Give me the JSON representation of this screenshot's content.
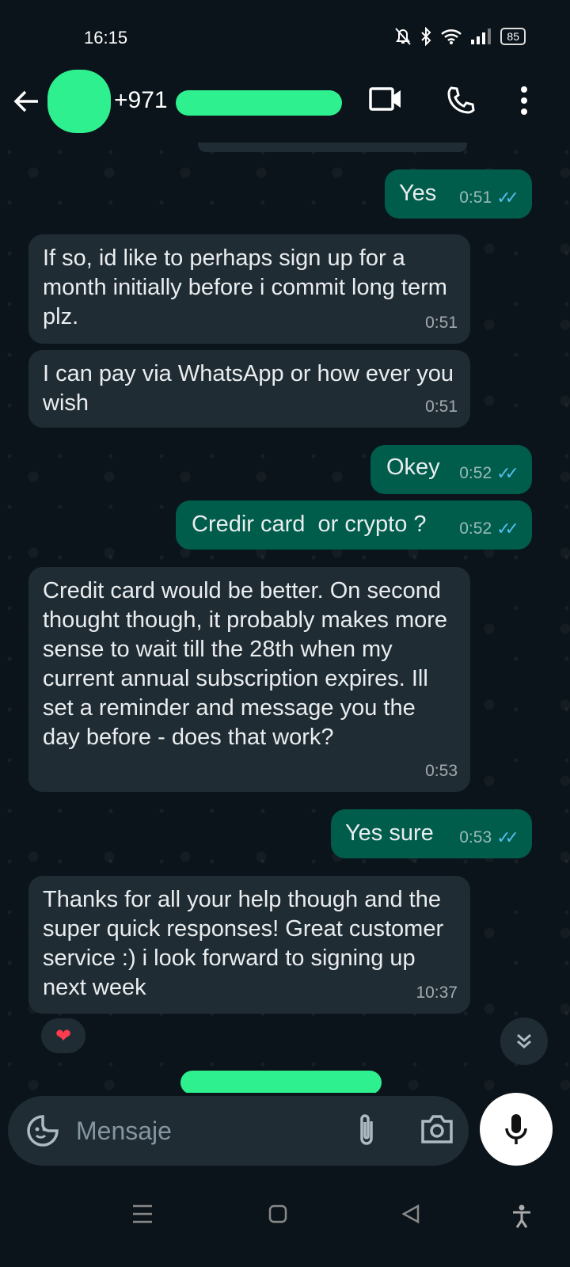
{
  "status_bar": {
    "time": "16:15",
    "battery": "85"
  },
  "header": {
    "contact": "+971"
  },
  "messages": [
    {
      "side": "out",
      "text": "Yes",
      "time": "0:51"
    },
    {
      "side": "in",
      "text": "If so, id like to perhaps sign up for a month initially before i commit long term plz.",
      "time": "0:51"
    },
    {
      "side": "in",
      "text": "I can pay via WhatsApp or how ever you wish",
      "time": "0:51"
    },
    {
      "side": "out",
      "text": "Okey",
      "time": "0:52"
    },
    {
      "side": "out",
      "text": "Credir card  or crypto ?",
      "time": "0:52"
    },
    {
      "side": "in",
      "text": "Credit card would be better. On second thought though, it probably makes more sense to wait till the 28th when my current annual subscription expires. Ill set a reminder and message you the day before - does that work?",
      "time": "0:53"
    },
    {
      "side": "out",
      "text": "Yes sure",
      "time": "0:53"
    },
    {
      "side": "in",
      "text": "Thanks for all your help though and the super quick responses! Great customer service :) i look forward to signing up next week",
      "time": "10:37",
      "reaction": "❤"
    }
  ],
  "composer": {
    "placeholder": "Mensaje"
  },
  "icons": {
    "back": "arrow-left-icon",
    "video": "video-call-icon",
    "call": "phone-icon",
    "menu": "more-vert-icon",
    "emoji": "sticker-icon",
    "attach": "paperclip-icon",
    "camera": "camera-icon",
    "mic": "mic-icon",
    "scroll": "double-chevron-down-icon"
  },
  "colors": {
    "background": "#0b141a",
    "incoming": "#202c33",
    "outgoing": "#005c4b",
    "read_ticks": "#53bdeb",
    "redaction": "#2ff08f"
  }
}
